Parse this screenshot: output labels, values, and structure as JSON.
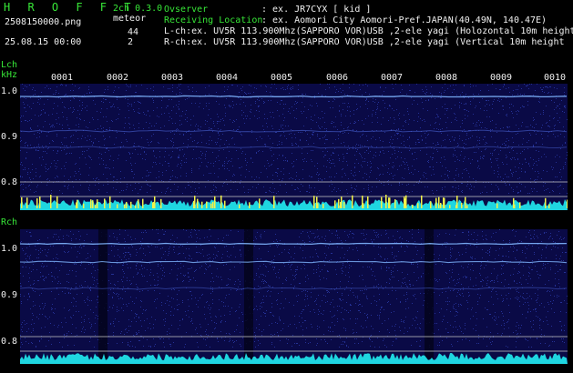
{
  "header": {
    "logo": "H R O F F T",
    "mode": "2ch 0.3.0",
    "meteor_label": "meteor",
    "filename": "2508150000.png",
    "datetime": "25.08.15 00:00",
    "lch_count": "44",
    "rch_count": "2",
    "observer_label": "Ovserver",
    "observer_value": ": ex. JR7CYX [ kid ]",
    "location_label": "Receiving Location",
    "location_value": ": ex. Aomori City Aomori-Pref.JAPAN(40.49N, 140.47E)",
    "lch_info": "L-ch:ex. UV5R 113.900Mhz(SAPPORO VOR)USB ,2-ele yagi (Holozontal 10m height",
    "rch_info": "R-ch:ex. UV5R 113.900Mhz(SAPPORO VOR)USB ,2-ele yagi (Vertical 10m height"
  },
  "lch": {
    "title": "Lch",
    "unit": "kHz",
    "y_labels": [
      "1.0",
      "0.9",
      "0.8"
    ],
    "time_labels": [
      "0001",
      "0002",
      "0003",
      "0004",
      "0005",
      "0006",
      "0007",
      "0008",
      "0009",
      "0010"
    ]
  },
  "rch": {
    "title": "Rch",
    "y_labels": [
      "1.0",
      "0.9",
      "0.8"
    ]
  },
  "colors": {
    "text_green": "#37e637",
    "text_white": "#f0f0f0",
    "spectrum_bg": "#0a0a46",
    "carrier": "#7fb6ff",
    "level": "#1fd6e0",
    "meteor": "#f2f24a"
  }
}
